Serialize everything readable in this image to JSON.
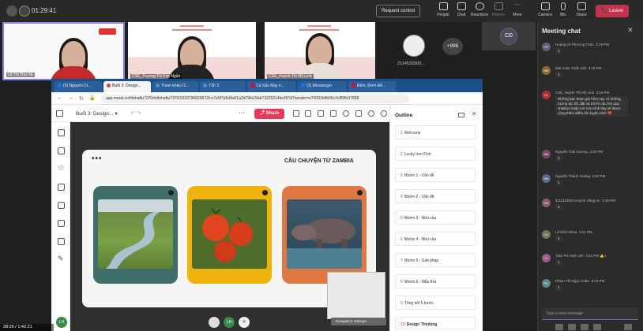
{
  "teams": {
    "timer": "01:29:41",
    "request_control": "Request control",
    "toolbar": [
      {
        "label": "People",
        "icon": "people-icon"
      },
      {
        "label": "Chat",
        "icon": "chat-icon"
      },
      {
        "label": "Reactions",
        "icon": "reactions-icon"
      },
      {
        "label": "Rooms",
        "icon": "rooms-icon"
      },
      {
        "label": "More",
        "icon": "more-icon"
      },
      {
        "label": "Camera",
        "icon": "camera-icon"
      },
      {
        "label": "Mic",
        "icon": "mic-icon"
      },
      {
        "label": "Share",
        "icon": "share-icon"
      }
    ],
    "leave": "Leave"
  },
  "participants": {
    "tiles": [
      {
        "name": "Lê Thị Thu Hà"
      },
      {
        "name": "CSE_Trương Thị Kim Ngân"
      },
      {
        "name": "CSE_Huỳnh Thị Mỹ Linh"
      }
    ],
    "small_name": "2114533300...",
    "more_count": "+996",
    "initials": "CĐ"
  },
  "chat": {
    "title": "Meeting chat",
    "messages": [
      {
        "initials": "HT",
        "name": "Hoàng Lê Phương Thảo",
        "time": "3:19 PM",
        "text": "1"
      },
      {
        "initials": "MK",
        "name": "Mai Xuân Tuấn Kiệt",
        "time": "3:19 PM",
        "text": "1"
      },
      {
        "initials": "CL",
        "name": "CSE_Huỳnh Thị Mỹ Linh",
        "time": "3:19 PM",
        "text": "Những bạn tham gia hôm nay có những tương tác tốt, đặt và trả lời câu hỏi qua chatbox hoặc mở mic trình bày sẽ được cộng thêm điểm rèn luyện nhé! ❤️"
      },
      {
        "initials": "ND",
        "name": "Nguyễn Thái Dương",
        "time": "3:20 PM",
        "text": "1"
      },
      {
        "initials": "NH",
        "name": "Nguyễn Thành Hoàng",
        "time": "3:20 PM",
        "text": "1"
      },
      {
        "initials": "HA",
        "name": "2111113003-Huỳnh Hồng An",
        "time": "3:20 PM",
        "text": "1"
      },
      {
        "initials": "LK",
        "name": "Lê Đình Khoa",
        "time": "3:21 PM",
        "text": "1"
      },
      {
        "initials": "TL",
        "name": "Trần Thị Huệ Linh",
        "time": "3:22 PM",
        "text": "1"
      },
      {
        "initials": "PC",
        "name": "Phạm Thị Ngọc Châu",
        "time": "3:23 PM",
        "text": "1"
      }
    ],
    "compose_placeholder": "Type a new message"
  },
  "browser": {
    "tabs": [
      {
        "label": "(5) Nguyen Di...",
        "color": "#1877f2"
      },
      {
        "label": "Buổi 3: Design...",
        "color": "#e8385b"
      },
      {
        "label": "Tham khảo CI...",
        "color": "#4a90d9"
      },
      {
        "label": "Y2F 2",
        "color": "#4a90d9"
      },
      {
        "label": "Cá Sấu Mạy n...",
        "color": "#ff0000"
      },
      {
        "label": "(3) Messenger",
        "color": "#1877f2"
      },
      {
        "label": "Đèm, Đơm Đê...",
        "color": "#ff0000"
      }
    ],
    "url": "app.mural.co/t/lehaftu7370/m/lehaftu7370/1633796659672/cc7e0f7a5d9a01a2d79fe19ab73225314bc957d?sender=u70091b9b05c2c85ffe37858"
  },
  "mural": {
    "breadcrumb": "Buổi 3: Design...",
    "share": "Share",
    "card_title": "CÂU CHUYỆN TỪ ZAMBIA",
    "card_dots": "•••",
    "photos": [
      {
        "name": "river",
        "bg": "#3f6e6a"
      },
      {
        "name": "tomatoes",
        "bg": "#f0b30d"
      },
      {
        "name": "hippo",
        "bg": "#e07843"
      }
    ],
    "navigation_settings": "Navigation Settings"
  },
  "outline": {
    "title": "Outline",
    "items": [
      {
        "num": "1",
        "label": "Welcome"
      },
      {
        "num": "2",
        "label": "Lucky Iron Fish"
      },
      {
        "num": "3",
        "label": "Nhóm 1 - Vấn đề"
      },
      {
        "num": "4",
        "label": "Nhóm 2 - Vấn đề"
      },
      {
        "num": "5",
        "label": "Nhóm 3 - Nhu cầu"
      },
      {
        "num": "6",
        "label": "Nhóm 4 - Nhu cầu"
      },
      {
        "num": "7",
        "label": "Nhóm 5 - Giải pháp"
      },
      {
        "num": "8",
        "label": "Nhóm 6 - Mẫu thử"
      },
      {
        "num": "9",
        "label": "Tổng kết 5 bước"
      },
      {
        "num": "10",
        "label": "Design Thinking"
      }
    ]
  },
  "bottom": {
    "video_label": "Lê Thị Hà",
    "time": "28:26 / 1:42:21",
    "lh_initials": "LH"
  }
}
